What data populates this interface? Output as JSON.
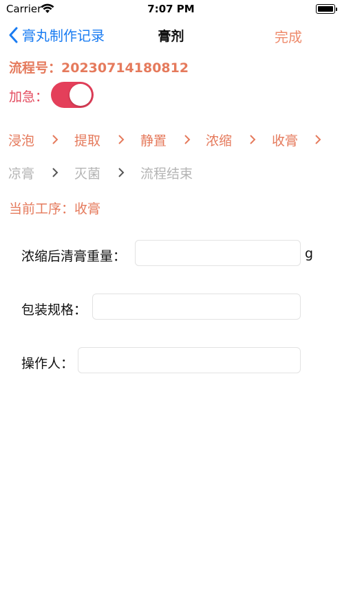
{
  "status_bar": {
    "carrier": "Carrier",
    "time": "7:07 PM"
  },
  "nav": {
    "back_label": "膏丸制作记录",
    "title": "膏剂",
    "done_label": "完成"
  },
  "process": {
    "label": "流程号：",
    "number": "20230714180812",
    "text": "流程号：20230714180812"
  },
  "urgent": {
    "label": "加急：",
    "on": true
  },
  "steps": [
    {
      "label": "浸泡",
      "state": "active"
    },
    {
      "label": "提取",
      "state": "active"
    },
    {
      "label": "静置",
      "state": "active"
    },
    {
      "label": "浓缩",
      "state": "active"
    },
    {
      "label": "收膏",
      "state": "active"
    },
    {
      "label": "凉膏",
      "state": "inactive"
    },
    {
      "label": "灭菌",
      "state": "inactive"
    },
    {
      "label": "流程结束",
      "state": "inactive"
    }
  ],
  "current_step": "当前工序：收膏",
  "form": {
    "weight": {
      "label": "浓缩后清膏重量：",
      "value": "",
      "unit": "g"
    },
    "package": {
      "label": "包装规格：",
      "value": ""
    },
    "operator": {
      "label": "操作人：",
      "value": ""
    }
  },
  "colors": {
    "accent": "#e57a5c",
    "link": "#1a7cf2",
    "toggle": "#e43f5a",
    "inactive": "#b4b4b4"
  }
}
